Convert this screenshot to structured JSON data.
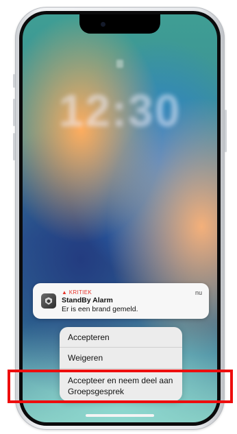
{
  "lockscreen": {
    "clock": "12:30",
    "date": "",
    "carrier": "",
    "battery": ""
  },
  "notification": {
    "level_icon": "warning-triangle-icon",
    "level_label": "KRITIEK",
    "app_name": "StandBy Alarm",
    "message": "Er is een brand gemeld.",
    "time": "nu",
    "app_icon": "standby-alarm-app-icon"
  },
  "actions": {
    "accept": "Accepteren",
    "decline": "Weigeren",
    "accept_and_join": "Accepteer en neem deel aan Groepsgesprek"
  },
  "colors": {
    "critical": "#e5332a",
    "highlight": "#ee0d0d"
  }
}
